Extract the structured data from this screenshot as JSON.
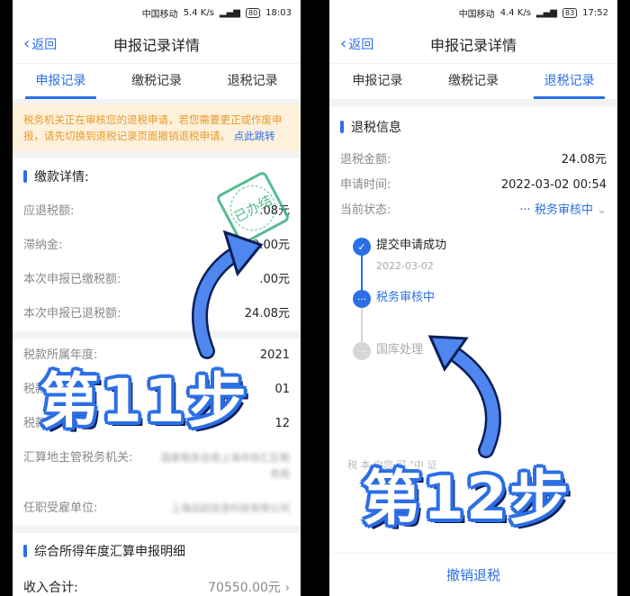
{
  "left": {
    "status": {
      "carrier": "中国移动",
      "net": "5.4 K/s",
      "battery": "80",
      "time": "18:03"
    },
    "back_label": "返回",
    "title": "申报记录详情",
    "tabs": [
      "申报记录",
      "缴税记录",
      "退税记录"
    ],
    "notice_text": "税务机关正在审核您的退税申请，若您需要更正或作废申报，请先切换到退税记录页面撤销退税申请。",
    "notice_link": "点此跳转",
    "payment_section_title": "缴款详情:",
    "payment_rows": [
      {
        "label": "应退税额:",
        "value": ".08元"
      },
      {
        "label": "滞纳金:",
        "value": "0.00元"
      },
      {
        "label": "本次申报已缴税额:",
        "value": ".00元"
      },
      {
        "label": "本次申报已退税额:",
        "value": "24.08元"
      }
    ],
    "stamp_text": "已办结",
    "info_rows": [
      {
        "label": "税款所属年度:",
        "value": "2021"
      },
      {
        "label": "税款所",
        "value": "01"
      },
      {
        "label": "税款所",
        "value": "12"
      }
    ],
    "authority_label": "汇算地主管税务机关:",
    "authority_value": "国家税务总局上海市徐汇区税务局",
    "employer_label": "任职受雇单位:",
    "employer_value": "上海品起信息科技有限公司",
    "detail_section_title": "综合所得年度汇算申报明细",
    "income_label": "收入合计:",
    "income_value": "70550.00元",
    "step_label": "第11步"
  },
  "right": {
    "status": {
      "carrier": "中国移动",
      "net": "4.4 K/s",
      "battery": "83",
      "time": "17:52"
    },
    "back_label": "返回",
    "title": "申报记录详情",
    "tabs": [
      "申报记录",
      "缴税记录",
      "退税记录"
    ],
    "refund_section_title": "退税信息",
    "refund_rows": [
      {
        "label": "退税金额:",
        "value": "24.08元"
      },
      {
        "label": "申请时间:",
        "value": "2022-03-02 00:54"
      }
    ],
    "current_status_label": "当前状态:",
    "current_status_value": "··· 税务审核中",
    "timeline": [
      {
        "title": "提交申请成功",
        "date": "2022-03-02",
        "state": "done"
      },
      {
        "title": "税务审核中",
        "date": "",
        "state": "current"
      },
      {
        "title": "国库处理",
        "date": "",
        "state": "pending"
      }
    ],
    "ghost_text": "税 本 向您 可 \"中 证",
    "cancel_button": "撤销退税",
    "step_label": "第12步"
  },
  "colors": {
    "accent": "#2b6fe8",
    "notice_bg": "#fdf1dc",
    "notice_text": "#e79a2b",
    "stamp": "#3ab07d"
  }
}
